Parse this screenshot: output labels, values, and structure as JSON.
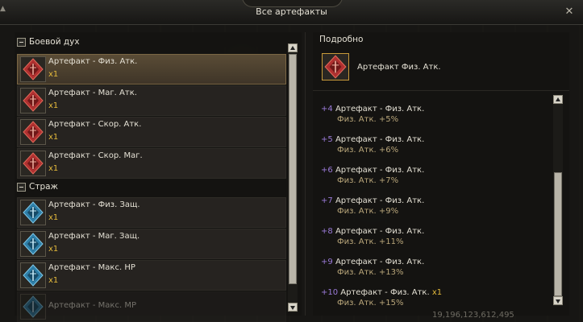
{
  "window": {
    "title": "Все артефакты",
    "close_icon": "close-icon"
  },
  "left": {
    "groups": [
      {
        "label": "Боевой дух",
        "items": [
          {
            "name": "Артефакт - Физ. Атк.",
            "qty": "x1",
            "icon": "red-artifact-icon",
            "selected": true
          },
          {
            "name": "Артефакт - Маг. Атк.",
            "qty": "x1",
            "icon": "red-artifact-icon"
          },
          {
            "name": "Артефакт - Скор. Атк.",
            "qty": "x1",
            "icon": "red-artifact-icon"
          },
          {
            "name": "Артефакт - Скор. Маг.",
            "qty": "x1",
            "icon": "red-artifact-icon"
          }
        ]
      },
      {
        "label": "Страж",
        "items": [
          {
            "name": "Артефакт - Физ. Защ.",
            "qty": "x1",
            "icon": "blue-artifact-icon"
          },
          {
            "name": "Артефакт - Маг. Защ.",
            "qty": "x1",
            "icon": "blue-artifact-icon"
          },
          {
            "name": "Артефакт - Макс. HP",
            "qty": "x1",
            "icon": "blue-artifact-icon"
          },
          {
            "name": "Артефакт - Макс. MP",
            "qty": "",
            "icon": "blue-artifact-icon",
            "dimmed": true
          }
        ]
      }
    ]
  },
  "right": {
    "title": "Подробно",
    "selected_name": "Артефакт Физ. Атк.",
    "levels": [
      {
        "plus": "+4",
        "name": "Артефакт - Физ. Атк.",
        "stat": "Физ. Атк. +5%"
      },
      {
        "plus": "+5",
        "name": "Артефакт - Физ. Атк.",
        "stat": "Физ. Атк. +6%"
      },
      {
        "plus": "+6",
        "name": "Артефакт - Физ. Атк.",
        "stat": "Физ. Атк. +7%"
      },
      {
        "plus": "+7",
        "name": "Артефакт - Физ. Атк.",
        "stat": "Физ. Атк. +9%"
      },
      {
        "plus": "+8",
        "name": "Артефакт - Физ. Атк.",
        "stat": "Физ. Атк. +11%"
      },
      {
        "plus": "+9",
        "name": "Артефакт - Физ. Атк.",
        "stat": "Физ. Атк. +13%"
      },
      {
        "plus": "+10",
        "name": "Артефакт - Физ. Атк.",
        "qty": "x1",
        "stat": "Физ. Атк. +15%"
      }
    ]
  },
  "background_number": "19,196,123,612,495",
  "colors": {
    "red_artifact": "#b03030",
    "blue_artifact": "#2e7fa8",
    "accent_gold": "#e3b93b",
    "plus_purple": "#9a7ad8"
  }
}
